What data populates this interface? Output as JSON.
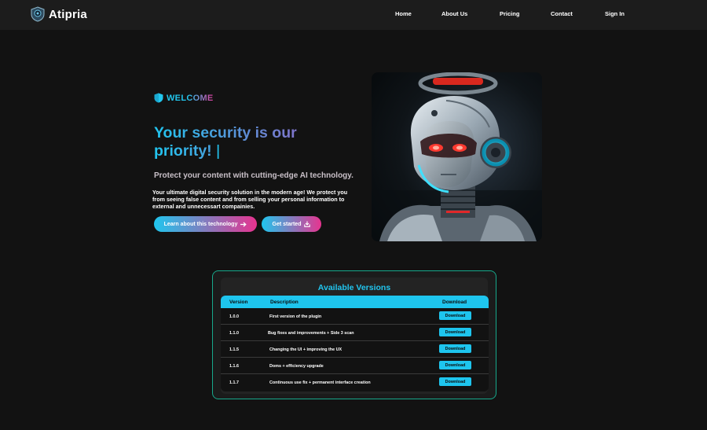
{
  "brand": {
    "name": "Atipria"
  },
  "nav": {
    "items": [
      {
        "label": "Home"
      },
      {
        "label": "About Us"
      },
      {
        "label": "Pricing"
      },
      {
        "label": "Contact"
      },
      {
        "label": "Sign In"
      }
    ]
  },
  "hero": {
    "welcome": "WELCOME",
    "headline": "Your security is our priority!",
    "cursor": "|",
    "tagline": "Protect your content with cutting-edge AI technology.",
    "description": "Your ultimate digital security solution in the modern age! We protect you from seeing false content and from selling your personal information to external and unnecessart compainies.",
    "btn_learn": "Learn about this technology",
    "btn_start": "Get started"
  },
  "versions": {
    "title": "Available Versions",
    "columns": {
      "version": "Version",
      "description": "Description",
      "download": "Download"
    },
    "rows": [
      {
        "version": "1.0.0",
        "description": "First version of the plugin",
        "action": "Download"
      },
      {
        "version": "1.1.0",
        "description": "Bug fixes and improvements + Side 3 scan",
        "action": "Download"
      },
      {
        "version": "1.1.5",
        "description": "Changing the UI + improving the UX",
        "action": "Download"
      },
      {
        "version": "1.1.6",
        "description": "Doms + efficiency upgrade",
        "action": "Download"
      },
      {
        "version": "1.1.7",
        "description": "Continuous use fix + permanent interface creation",
        "action": "Download"
      }
    ]
  },
  "colors": {
    "accent_cyan": "#1ec5ee",
    "accent_pink": "#e7338f",
    "border_teal": "#17a88b",
    "background": "#121212",
    "navbar": "#1c1c1c"
  },
  "icons": {
    "logo": "shield-logo-icon",
    "welcome": "shield-icon",
    "learn": "arrow-right-icon",
    "start": "download-icon"
  }
}
